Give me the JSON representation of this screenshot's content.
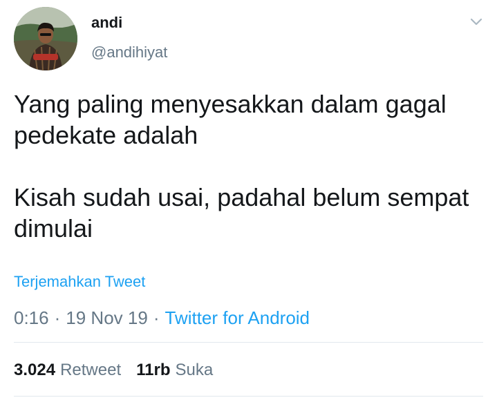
{
  "user": {
    "display_name": "andi",
    "handle": "@andihiyat"
  },
  "tweet": {
    "paragraphs": [
      "Yang paling menyesakkan dalam gagal pedekate adalah",
      "Kisah sudah usai, padahal belum sempat dimulai"
    ],
    "translate_label": "Terjemahkan Tweet",
    "time": "0:16",
    "date": "19 Nov 19",
    "separator": "·",
    "source": "Twitter for Android"
  },
  "stats": {
    "retweet_count": "3.024",
    "retweet_label": "Retweet",
    "like_count": "11rb",
    "like_label": "Suka"
  },
  "icons": {
    "menu": "chevron-down-icon",
    "avatar": "profile-photo"
  },
  "colors": {
    "link": "#1da1f2",
    "text": "#14171a",
    "secondary": "#657786",
    "divider": "#e1e8ed"
  }
}
